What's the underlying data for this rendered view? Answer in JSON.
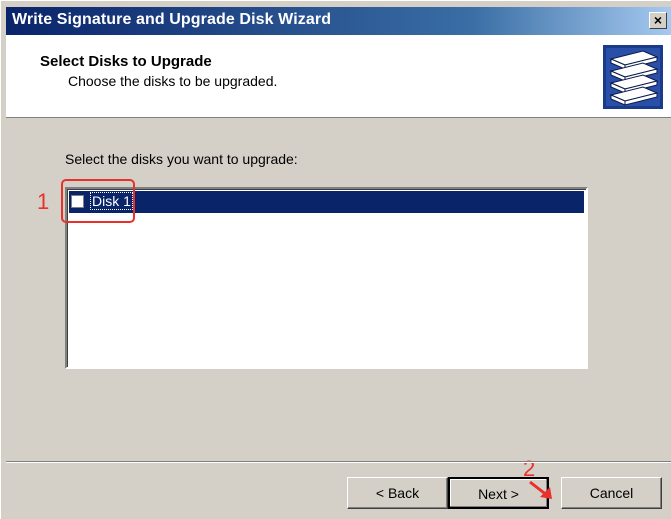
{
  "window": {
    "title": "Write Signature and Upgrade Disk Wizard",
    "close_glyph": "×"
  },
  "header": {
    "title": "Select Disks to Upgrade",
    "subtitle": "Choose the disks to be upgraded.",
    "icon": "disk-stack-icon"
  },
  "main": {
    "instruction": "Select the disks you want to upgrade:",
    "disks": [
      {
        "label": "Disk 1",
        "checked": false,
        "selected": true
      }
    ]
  },
  "annotations": {
    "step1": "1",
    "step2": "2",
    "color": "#e8312a"
  },
  "buttons": {
    "back": "< Back",
    "next": "Next >",
    "cancel": "Cancel"
  },
  "colors": {
    "title_bar": "#0a246a",
    "selection": "#0a246a",
    "dialog_bg": "#d4d0c8"
  }
}
